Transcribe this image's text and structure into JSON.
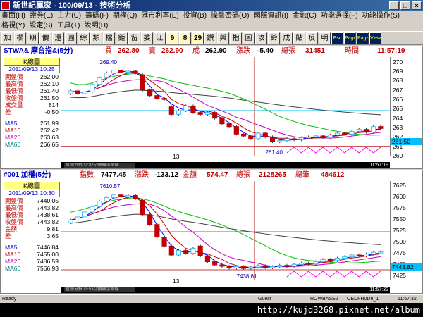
{
  "window": {
    "title": "新世紀贏家 - 100/09/13 - 技術分析"
  },
  "menubar1": [
    "畫面(H)",
    "證券(E)",
    "主力(U)",
    "籌碼(F)",
    "期權(Q)",
    "匯市利率(E)",
    "投資(B)",
    "操盤密碼(O)",
    "國際資訊(I)",
    "金融(C)",
    "功能選擇(F)",
    "功能操作(S)"
  ],
  "menubar2": [
    "格視(Y)",
    "設定(S)",
    "工具(T)",
    "說明(H)"
  ],
  "toolbar": [
    "加",
    "欄",
    "期",
    "價",
    "還",
    "圓",
    "綜",
    "類",
    "檔",
    "鉅",
    "留",
    "委",
    "江",
    "9",
    "8",
    "29",
    "饌",
    "興",
    "指",
    "圖",
    "攻",
    "鈴",
    "成",
    "貼",
    "反",
    "明",
    "Esc",
    "Page",
    "Page",
    "View"
  ],
  "panel1": {
    "symbol": "STWA& 摩台指&(5分)",
    "buy_label": "買",
    "buy": "262.80",
    "sell_label": "賣",
    "sell": "262.90",
    "deal_label": "成",
    "deal": "262.90",
    "chg_label": "漲跌",
    "chg": "-5.40",
    "vol_label": "總張",
    "vol": "31451",
    "time_label": "時間",
    "time": "11:57:19",
    "info_title": "K線圖",
    "info_date": "2011/09/13 10:25",
    "info_rows": [
      {
        "k": "開盤價",
        "v": "262.00"
      },
      {
        "k": "最高價",
        "v": "262.10"
      },
      {
        "k": "最低價",
        "v": "261.40"
      },
      {
        "k": "收盤價",
        "v": "261.50"
      },
      {
        "k": "成交量",
        "v": "814"
      },
      {
        "k": "差",
        "v": "-0.50"
      }
    ],
    "ma_rows": [
      {
        "k": "MA5",
        "v": "261.99"
      },
      {
        "k": "MA10",
        "v": "262.42"
      },
      {
        "k": "MA20",
        "v": "263.63"
      },
      {
        "k": "MA60",
        "v": "266.65"
      }
    ],
    "axis_ticks": [
      "270",
      "269",
      "268",
      "267",
      "266",
      "265",
      "264",
      "263",
      "262",
      "261",
      "260"
    ],
    "current": "261.50",
    "high_label": "269.40",
    "low_label": "261.40",
    "x_label": "13",
    "scroll_text": "看漲分析:<F5>切換顯示格線",
    "scroll_time": "11:57:19"
  },
  "panel2": {
    "symbol": "#001 加權(5分)",
    "idx_label": "指數",
    "idx": "7477.45",
    "chg_label": "漲跌",
    "chg": "-133.12",
    "amt_label": "金額",
    "amt": "574.47",
    "vol_label": "總張",
    "vol": "2128265",
    "cnt_label": "總筆",
    "cnt": "484612",
    "info_title": "K線圖",
    "info_date": "2011/09/13 10:30",
    "info_rows": [
      {
        "k": "開盤價",
        "v": "7440.05"
      },
      {
        "k": "最高價",
        "v": "7443.82"
      },
      {
        "k": "最低價",
        "v": "7438.61"
      },
      {
        "k": "收盤價",
        "v": "7443.82"
      },
      {
        "k": "金額",
        "v": "9.81"
      },
      {
        "k": "差",
        "v": "3.65"
      }
    ],
    "ma_rows": [
      {
        "k": "MA5",
        "v": "7446.84"
      },
      {
        "k": "MA10",
        "v": "7455.00"
      },
      {
        "k": "MA20",
        "v": "7486.59"
      },
      {
        "k": "MA60",
        "v": "7566.93"
      }
    ],
    "axis_ticks": [
      "7625",
      "7600",
      "7575",
      "7550",
      "7525",
      "7500",
      "7475",
      "7450",
      "7425"
    ],
    "current": "7443.82",
    "high_label": "7610.57",
    "low_label": "7438.61",
    "x_label": "13",
    "scroll_text": "看漲分析:<F5>切換顯示格線",
    "scroll_time": "11:57:32"
  },
  "statusbar": {
    "ready": "Ready",
    "user": "Guest",
    "server": "ROWBASE2",
    "session": "OEDFR0D8_1",
    "clock": "11:57:32"
  },
  "watermark": "http://kujd3268.pixnet.net/album",
  "chart_data": [
    {
      "type": "candlestick",
      "title": "STWA& 摩台指&(5分)",
      "ylim": [
        260,
        270.5
      ],
      "annotations": [
        "269.40",
        "261.40",
        "13"
      ],
      "candles": [
        {
          "o": 266.6,
          "c": 266.9
        },
        {
          "o": 266.9,
          "c": 266.6
        },
        {
          "o": 266.6,
          "c": 266.8
        },
        {
          "o": 266.8,
          "c": 267.6
        },
        {
          "o": 267.6,
          "c": 268.3
        },
        {
          "o": 268.3,
          "c": 268.8
        },
        {
          "o": 268.8,
          "c": 269.1
        },
        {
          "o": 269.1,
          "c": 268.9
        },
        {
          "o": 268.9,
          "c": 269.0
        },
        {
          "o": 269.0,
          "c": 268.8
        },
        {
          "o": 268.6,
          "c": 267.0
        },
        {
          "o": 267.0,
          "c": 266.4
        },
        {
          "o": 266.4,
          "c": 266.1
        },
        {
          "o": 266.1,
          "c": 266.0
        },
        {
          "o": 265.2,
          "c": 264.4
        },
        {
          "o": 264.4,
          "c": 264.8
        },
        {
          "o": 264.8,
          "c": 265.3
        },
        {
          "o": 265.3,
          "c": 264.6
        },
        {
          "o": 264.6,
          "c": 264.4
        },
        {
          "o": 264.4,
          "c": 264.6
        },
        {
          "o": 264.6,
          "c": 264.0
        },
        {
          "o": 264.0,
          "c": 263.4
        },
        {
          "o": 263.4,
          "c": 263.1
        },
        {
          "o": 263.1,
          "c": 262.3
        },
        {
          "o": 262.3,
          "c": 262.1
        },
        {
          "o": 262.1,
          "c": 261.8
        },
        {
          "o": 261.8,
          "c": 262.4
        },
        {
          "o": 262.4,
          "c": 262.0
        },
        {
          "o": 262.0,
          "c": 261.5
        },
        {
          "o": 261.5,
          "c": 261.6
        },
        {
          "o": 261.6,
          "c": 261.8
        },
        {
          "o": 261.8,
          "c": 261.7
        },
        {
          "o": 261.7,
          "c": 261.9
        },
        {
          "o": 261.9,
          "c": 262.0
        },
        {
          "o": 262.0,
          "c": 262.1
        },
        {
          "o": 262.1,
          "c": 261.9
        },
        {
          "o": 261.9,
          "c": 262.2
        },
        {
          "o": 262.2,
          "c": 262.4
        },
        {
          "o": 262.4,
          "c": 262.3
        },
        {
          "o": 262.3,
          "c": 262.6
        },
        {
          "o": 262.6,
          "c": 262.8
        },
        {
          "o": 262.8,
          "c": 262.5
        },
        {
          "o": 262.5,
          "c": 263.1
        },
        {
          "o": 263.1,
          "c": 262.9
        }
      ]
    },
    {
      "type": "candlestick",
      "title": "#001 加權(5分)",
      "ylim": [
        7415,
        7635
      ],
      "annotations": [
        "7610.57",
        "7438.61",
        "13"
      ],
      "candles": [
        {
          "o": 7542,
          "c": 7548
        },
        {
          "o": 7548,
          "c": 7555
        },
        {
          "o": 7555,
          "c": 7566
        },
        {
          "o": 7566,
          "c": 7578
        },
        {
          "o": 7578,
          "c": 7590
        },
        {
          "o": 7590,
          "c": 7598
        },
        {
          "o": 7598,
          "c": 7604
        },
        {
          "o": 7604,
          "c": 7600
        },
        {
          "o": 7600,
          "c": 7603
        },
        {
          "o": 7603,
          "c": 7596
        },
        {
          "o": 7592,
          "c": 7560
        },
        {
          "o": 7560,
          "c": 7538
        },
        {
          "o": 7538,
          "c": 7510
        },
        {
          "o": 7510,
          "c": 7490
        },
        {
          "o": 7490,
          "c": 7470
        },
        {
          "o": 7470,
          "c": 7480
        },
        {
          "o": 7480,
          "c": 7474
        },
        {
          "o": 7474,
          "c": 7485
        },
        {
          "o": 7490,
          "c": 7468
        },
        {
          "o": 7468,
          "c": 7455
        },
        {
          "o": 7455,
          "c": 7448
        },
        {
          "o": 7448,
          "c": 7445
        },
        {
          "o": 7445,
          "c": 7441
        },
        {
          "o": 7441,
          "c": 7444
        },
        {
          "o": 7444,
          "c": 7440
        },
        {
          "o": 7440,
          "c": 7443
        },
        {
          "o": 7443,
          "c": 7446
        },
        {
          "o": 7446,
          "c": 7442
        },
        {
          "o": 7442,
          "c": 7444
        },
        {
          "o": 7444,
          "c": 7447
        },
        {
          "o": 7447,
          "c": 7445
        },
        {
          "o": 7445,
          "c": 7449
        },
        {
          "o": 7449,
          "c": 7452
        },
        {
          "o": 7452,
          "c": 7450
        },
        {
          "o": 7450,
          "c": 7455
        },
        {
          "o": 7455,
          "c": 7460
        },
        {
          "o": 7460,
          "c": 7458
        },
        {
          "o": 7458,
          "c": 7463
        },
        {
          "o": 7463,
          "c": 7466
        },
        {
          "o": 7466,
          "c": 7470
        },
        {
          "o": 7470,
          "c": 7468
        },
        {
          "o": 7468,
          "c": 7472
        },
        {
          "o": 7472,
          "c": 7476
        },
        {
          "o": 7476,
          "c": 7477
        }
      ]
    }
  ]
}
